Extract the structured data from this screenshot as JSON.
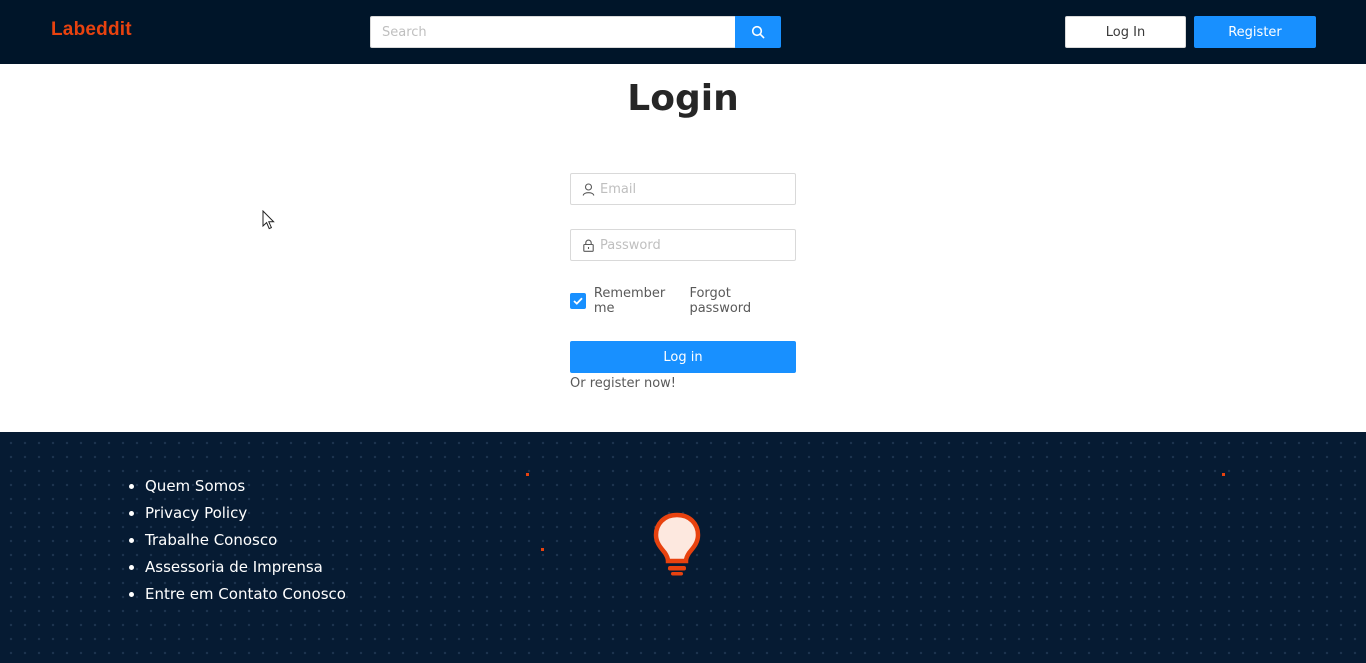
{
  "header": {
    "logo": "Labeddit",
    "search_placeholder": "Search",
    "login_label": "Log In",
    "register_label": "Register"
  },
  "main": {
    "title": "Login",
    "email_placeholder": "Email",
    "password_placeholder": "Password",
    "remember_label": "Remember me",
    "remember_checked": true,
    "forgot_label": "Forgot password",
    "submit_label": "Log in",
    "register_link": "Or register now!"
  },
  "footer": {
    "links": [
      "Quem Somos",
      "Privacy Policy",
      "Trabalhe Conosco",
      "Assessoria de Imprensa",
      "Entre em Contato Conosco"
    ]
  },
  "colors": {
    "header_bg": "#001529",
    "accent": "#1890ff",
    "brand": "#e8420f",
    "footer_bg": "#061b33"
  },
  "icons": [
    "search-icon",
    "user-icon",
    "lock-icon",
    "checkmark-icon",
    "lightbulb-icon",
    "mouse-cursor-icon"
  ]
}
